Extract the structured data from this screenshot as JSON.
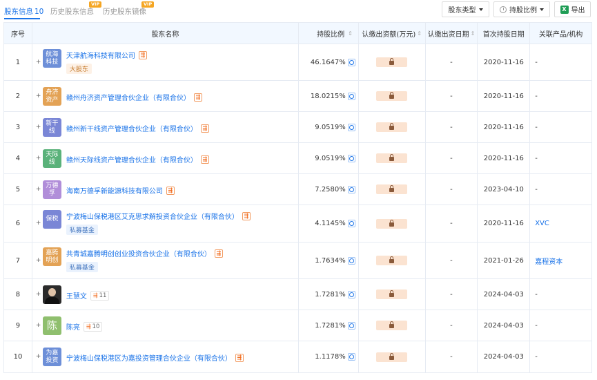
{
  "tabs": [
    {
      "label": "股东信息",
      "count": "10"
    },
    {
      "label": "历史股东信息",
      "vip": "VIP"
    },
    {
      "label": "历史股东镜像",
      "vip": "VIP"
    }
  ],
  "toolbar": {
    "type_filter": "股东类型",
    "ratio_filter": "持股比例",
    "export": "导出",
    "excel_icon_text": "X"
  },
  "headers": {
    "idx": "序号",
    "name": "股东名称",
    "ratio": "持股比例",
    "paid": "认缴出资额(万元)",
    "paid_date": "认缴出资日期",
    "first_date": "首次持股日期",
    "related": "关联产品/机构",
    "sort_glyph": "⇕"
  },
  "rows": [
    {
      "idx": "1",
      "logo": "航海科技",
      "logo_color": "#6d8fd8",
      "name": "天津航海科技有限公司",
      "tag": "大股东",
      "tag_style": "orange",
      "ratio": "46.1647%",
      "paid_date": "-",
      "first_date": "2020-11-16",
      "related": "-"
    },
    {
      "idx": "2",
      "logo": "舟济资产",
      "logo_color": "#e3a255",
      "name": "赣州舟济资产管理合伙企业（有限合伙）",
      "ratio": "18.0215%",
      "paid_date": "-",
      "first_date": "2020-11-16",
      "related": "-"
    },
    {
      "idx": "3",
      "logo": "新干线",
      "logo_color": "#7a86d6",
      "name": "赣州新干线资产管理合伙企业（有限合伙）",
      "ratio": "9.0519%",
      "paid_date": "-",
      "first_date": "2020-11-16",
      "related": "-"
    },
    {
      "idx": "4",
      "logo": "天际线",
      "logo_color": "#5ab27a",
      "name": "赣州天际线资产管理合伙企业（有限合伙）",
      "ratio": "9.0519%",
      "paid_date": "-",
      "first_date": "2020-11-16",
      "related": "-"
    },
    {
      "idx": "5",
      "logo": "万德孚",
      "logo_color": "#b18ed9",
      "name": "海南万德孚新能源科技有限公司",
      "ratio": "7.2580%",
      "paid_date": "-",
      "first_date": "2023-04-10",
      "related": "-"
    },
    {
      "idx": "6",
      "logo": "保税",
      "logo_color": "#7a86d6",
      "name": "宁波梅山保税港区艾克思求解投资合伙企业（有限合伙）",
      "tag": "私募基金",
      "tag_style": "blue",
      "ratio": "4.1145%",
      "paid_date": "-",
      "first_date": "2020-11-16",
      "related": "XVC",
      "related_link": true
    },
    {
      "idx": "7",
      "logo": "嘉腾明创",
      "logo_color": "#e3a255",
      "name": "共青城嘉腾明创创业投资合伙企业（有限合伙）",
      "tag": "私募基金",
      "tag_style": "blue",
      "ratio": "1.7634%",
      "paid_date": "-",
      "first_date": "2021-01-26",
      "related": "嘉程资本",
      "related_link": true
    },
    {
      "idx": "8",
      "logo": "",
      "logo_type": "photo",
      "name": "王慧文",
      "count": "11",
      "ratio": "1.7281%",
      "paid_date": "-",
      "first_date": "2024-04-03",
      "related": "-"
    },
    {
      "idx": "9",
      "logo": "陈",
      "logo_color": "#8fbf6e",
      "logo_type": "big",
      "name": "陈亮",
      "count": "10",
      "ratio": "1.7281%",
      "paid_date": "-",
      "first_date": "2024-04-03",
      "related": "-"
    },
    {
      "idx": "10",
      "logo": "为嘉投资",
      "logo_color": "#6d8fd8",
      "name": "宁波梅山保税港区为嘉投资管理合伙企业（有限合伙）",
      "ratio": "1.1178%",
      "paid_date": "-",
      "first_date": "2024-04-03",
      "related": "-"
    }
  ],
  "icons": {
    "expand": "plus-icon",
    "structure": "equity-structure-icon",
    "pie": "pie-chart-icon",
    "lock": "lock-icon"
  }
}
